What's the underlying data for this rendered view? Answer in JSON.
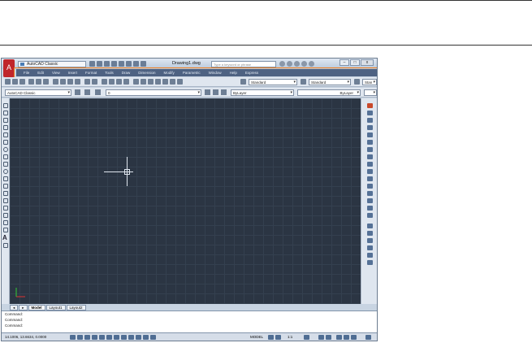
{
  "window": {
    "app_button": "A",
    "workspace": "AutoCAD Classic",
    "document_title": "Drawing1.dwg",
    "search_placeholder": "Type a keyword or phrase",
    "controls": [
      "–",
      "□",
      "x"
    ]
  },
  "menubar": {
    "items": [
      "File",
      "Edit",
      "View",
      "Insert",
      "Format",
      "Tools",
      "Draw",
      "Dimension",
      "Modify",
      "Parametric",
      "Window",
      "Help",
      "Express"
    ]
  },
  "toolbar1": {
    "text_style": "Standard",
    "dim_style": "Standard",
    "table_style_short": "Stan"
  },
  "toolbar2": {
    "workspace": "AutoCAD Classic",
    "layer": "0",
    "color": "ByLayer",
    "linetype": "ByLayer"
  },
  "tabs": {
    "items": [
      "Model",
      "Layout1",
      "Layout2"
    ]
  },
  "command": {
    "lines": [
      "Command:",
      "Command:",
      "Command:"
    ]
  },
  "status": {
    "coords": "14.1006, 13.6634, 0.0000",
    "model": "MODEL",
    "scale": "1:1"
  },
  "colors": {
    "canvas": "#2b3543",
    "highlight": "#f07f1f",
    "app_red": "#c0262b"
  }
}
